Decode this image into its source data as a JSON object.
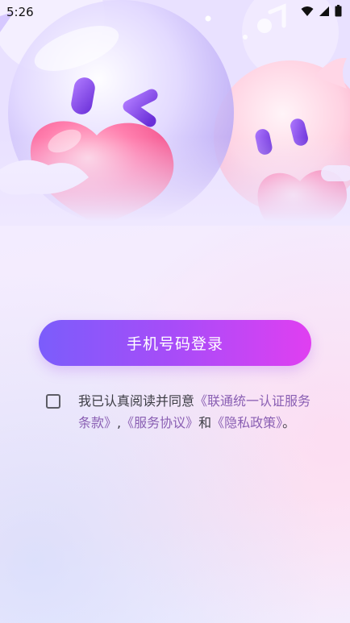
{
  "status_bar": {
    "time": "5:26"
  },
  "login": {
    "button_label": "手机号码登录"
  },
  "agreement": {
    "prefix": "我已认真阅读并同意",
    "link_1": "《联通统一认证服务条款》",
    "sep_1": ",",
    "link_2": "《服务协议》",
    "and": "和",
    "link_3": "《隐私政策》",
    "suffix": "。"
  },
  "colors": {
    "button_gradient_start": "#7b5dfb",
    "button_gradient_end": "#e03ff1",
    "link": "#8a5fb3"
  }
}
